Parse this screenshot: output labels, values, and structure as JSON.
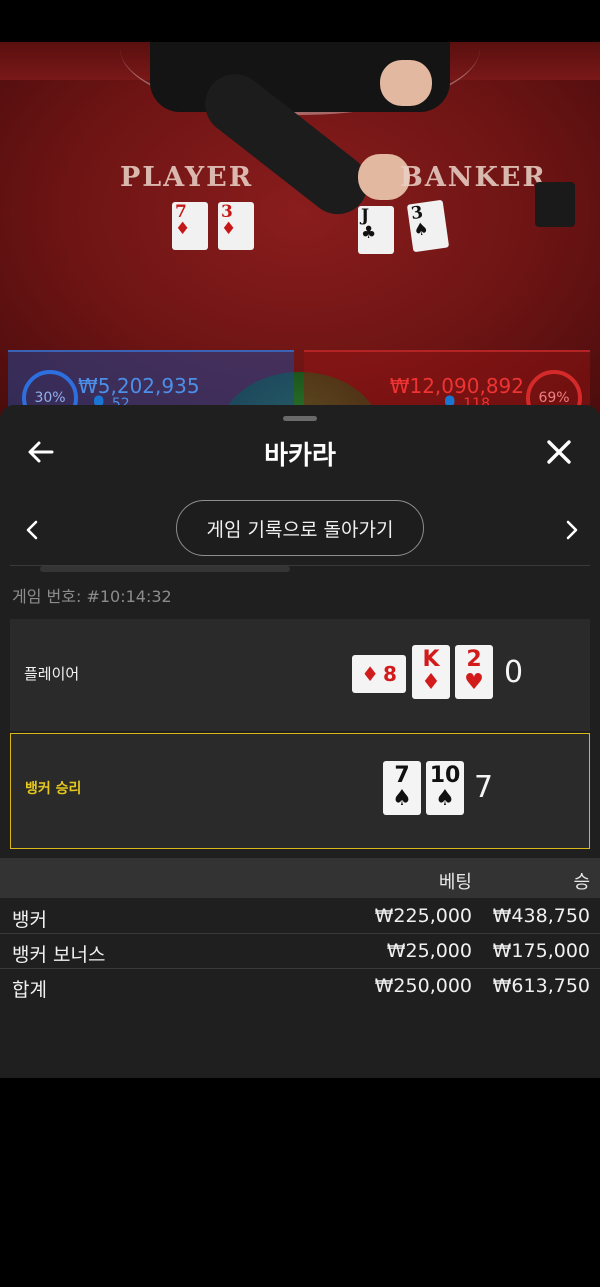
{
  "video": {
    "player_label": "PLAYER",
    "banker_label": "BANKER",
    "player_cards": [
      {
        "rank": "7",
        "suit": "♦",
        "color": "#c41818"
      },
      {
        "rank": "3",
        "suit": "♦",
        "color": "#c41818"
      }
    ],
    "banker_cards": [
      {
        "rank": "J",
        "suit": "♣",
        "color": "#111111"
      },
      {
        "rank": "3",
        "suit": "♠",
        "color": "#111111"
      }
    ],
    "player_stats": {
      "percent": "30%",
      "amount": "₩5,202,935",
      "users": "52"
    },
    "banker_stats": {
      "percent": "69%",
      "amount": "₩12,090,892",
      "users": "118"
    }
  },
  "sheet": {
    "title": "바카라",
    "back_to_history_label": "게임 기록으로 돌아가기",
    "game_number": "게임 번호: #10:14:32",
    "player_row": {
      "label": "플레이어",
      "score": "0",
      "cards": [
        {
          "rank": "8",
          "suit": "♦",
          "color": "#d21c1c",
          "sideways": true
        },
        {
          "rank": "K",
          "suit": "♦",
          "color": "#d21c1c",
          "sideways": false
        },
        {
          "rank": "2",
          "suit": "♥",
          "color": "#d21c1c",
          "sideways": false
        }
      ]
    },
    "banker_row": {
      "label": "뱅커 승리",
      "score": "7",
      "cards": [
        {
          "rank": "7",
          "suit": "♠",
          "color": "#111111",
          "sideways": false
        },
        {
          "rank": "10",
          "suit": "♠",
          "color": "#111111",
          "sideways": false
        }
      ]
    },
    "bets": {
      "header_bet": "베팅",
      "header_win": "승",
      "rows": [
        {
          "name": "뱅커",
          "bet": "₩225,000",
          "win": "₩438,750"
        },
        {
          "name": "뱅커 보너스",
          "bet": "₩25,000",
          "win": "₩175,000"
        },
        {
          "name": "합계",
          "bet": "₩250,000",
          "win": "₩613,750"
        }
      ]
    },
    "accent_color": "#d9b81e"
  }
}
